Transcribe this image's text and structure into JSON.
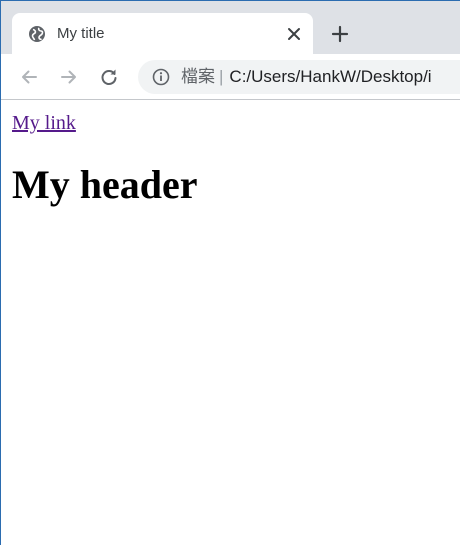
{
  "browser": {
    "tab": {
      "title": "My title",
      "favicon": "globe-icon"
    },
    "new_tab_icon": "plus-icon",
    "toolbar": {
      "back_icon": "arrow-left-icon",
      "forward_icon": "arrow-right-icon",
      "reload_icon": "reload-icon",
      "address": {
        "info_icon": "info-icon",
        "scheme_label": "檔案",
        "separator": "|",
        "url": "C:/Users/HankW/Desktop/i"
      }
    }
  },
  "page": {
    "link_text": "My link",
    "header": "My header"
  },
  "colors": {
    "tabstrip": "#dee1e6",
    "omnibox": "#f1f3f4",
    "visited_link": "#551a8b",
    "icon": "#5f6368"
  }
}
